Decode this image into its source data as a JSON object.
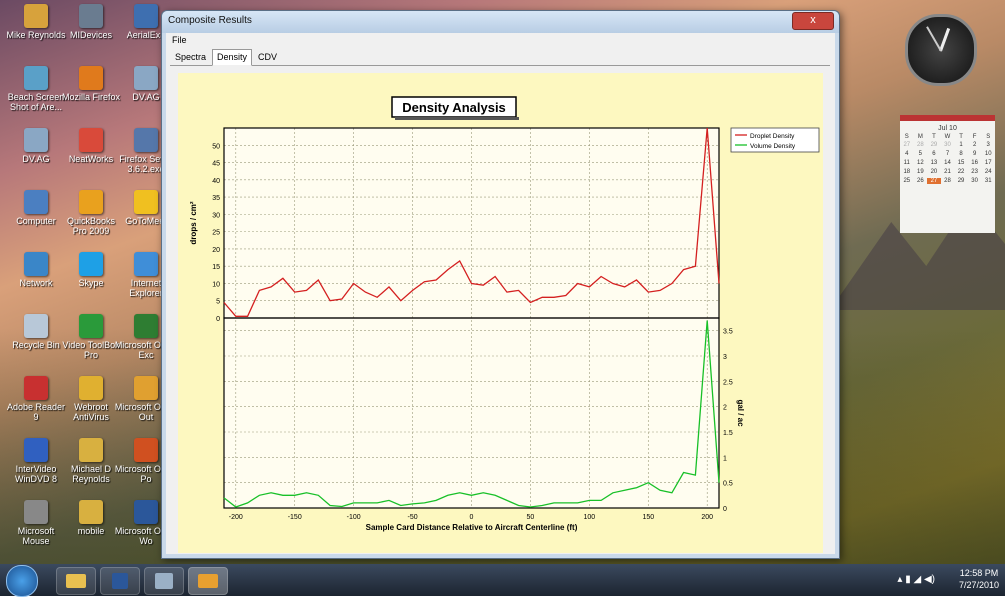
{
  "desktop": {
    "icons": [
      {
        "label": "Mike Reynolds",
        "color": "#d7a23c",
        "col": 0,
        "row": 0
      },
      {
        "label": "MIDevices",
        "color": "#6a7c90",
        "col": 1,
        "row": 0
      },
      {
        "label": "AerialExp",
        "color": "#3e6fb0",
        "col": 2,
        "row": 0
      },
      {
        "label": "Beach Screen Shot of Are...",
        "color": "#5aa0c8",
        "col": 0,
        "row": 1
      },
      {
        "label": "Mozilla Firefox",
        "color": "#e07a1c",
        "col": 1,
        "row": 1
      },
      {
        "label": "DV.AG",
        "color": "#8aa7c4",
        "col": 2,
        "row": 1
      },
      {
        "label": "DV.AG",
        "color": "#8aa7c4",
        "col": 0,
        "row": 2
      },
      {
        "label": "NeatWorks",
        "color": "#d94a3a",
        "col": 1,
        "row": 2
      },
      {
        "label": "Firefox Setup 3.6.2.exe",
        "color": "#5577aa",
        "col": 2,
        "row": 2
      },
      {
        "label": "Computer",
        "color": "#4b7fc1",
        "col": 0,
        "row": 3
      },
      {
        "label": "QuickBooks Pro 2009",
        "color": "#e9a11e",
        "col": 1,
        "row": 3
      },
      {
        "label": "GoToMeet",
        "color": "#f0c020",
        "col": 2,
        "row": 3
      },
      {
        "label": "Network",
        "color": "#3a86c8",
        "col": 0,
        "row": 4
      },
      {
        "label": "Skype",
        "color": "#1ea0e6",
        "col": 1,
        "row": 4
      },
      {
        "label": "Internet Explorer",
        "color": "#3f8ed8",
        "col": 2,
        "row": 4
      },
      {
        "label": "Recycle Bin",
        "color": "#b8c8d8",
        "col": 0,
        "row": 5
      },
      {
        "label": "Video ToolBox Pro",
        "color": "#2a9a3a",
        "col": 1,
        "row": 5
      },
      {
        "label": "Microsoft Office Exc",
        "color": "#2e7d32",
        "col": 2,
        "row": 5
      },
      {
        "label": "Adobe Reader 9",
        "color": "#c83030",
        "col": 0,
        "row": 6
      },
      {
        "label": "Webroot AntiVirus",
        "color": "#e0b030",
        "col": 1,
        "row": 6
      },
      {
        "label": "Microsoft Office Out",
        "color": "#e0a030",
        "col": 2,
        "row": 6
      },
      {
        "label": "InterVideo WinDVD 8",
        "color": "#3060c0",
        "col": 0,
        "row": 7
      },
      {
        "label": "Michael D Reynolds",
        "color": "#d8b040",
        "col": 1,
        "row": 7
      },
      {
        "label": "Microsoft Office Po",
        "color": "#d05020",
        "col": 2,
        "row": 7
      },
      {
        "label": "Microsoft Mouse",
        "color": "#888888",
        "col": 0,
        "row": 8
      },
      {
        "label": "mobile",
        "color": "#d8b040",
        "col": 1,
        "row": 8
      },
      {
        "label": "Microsoft Office Wo",
        "color": "#2b579a",
        "col": 2,
        "row": 8
      }
    ]
  },
  "window": {
    "title": "Composite Results",
    "close_label": "x",
    "menu": [
      "File"
    ],
    "tabs": [
      {
        "label": "Spectra",
        "active": false
      },
      {
        "label": "Density",
        "active": true
      },
      {
        "label": "CDV",
        "active": false
      }
    ]
  },
  "gadgets": {
    "calendar_header": "Jul 10",
    "weekdays": [
      "S",
      "M",
      "T",
      "W",
      "T",
      "F",
      "S"
    ],
    "days": [
      "27",
      "28",
      "29",
      "30",
      "1",
      "2",
      "3",
      "4",
      "5",
      "6",
      "7",
      "8",
      "9",
      "10",
      "11",
      "12",
      "13",
      "14",
      "15",
      "16",
      "17",
      "18",
      "19",
      "20",
      "21",
      "22",
      "23",
      "24",
      "25",
      "26",
      "27",
      "28",
      "29",
      "30",
      "31"
    ],
    "today": "27"
  },
  "taskbar": {
    "time": "12:58 PM",
    "date": "7/27/2010"
  },
  "chart_data": {
    "type": "line",
    "title": "Density Analysis",
    "xlabel": "Sample Card Distance Relative to Aircraft Centerline (ft)",
    "x_ticks": [
      -200,
      -150,
      -100,
      -50,
      0,
      50,
      100,
      150,
      200
    ],
    "xlim": [
      -210,
      210
    ],
    "legend": [
      "Droplet Density",
      "Volume Density"
    ],
    "legend_position": "top-right",
    "grid": true,
    "top_panel": {
      "ylabel": "drops / cm²",
      "ylim": [
        0,
        55
      ],
      "y_ticks": [
        0,
        5,
        10,
        15,
        20,
        25,
        30,
        35,
        40,
        45,
        50
      ],
      "series": [
        {
          "name": "Droplet Density",
          "color": "#d42020",
          "x": [
            -210,
            -200,
            -190,
            -180,
            -170,
            -160,
            -150,
            -140,
            -130,
            -120,
            -110,
            -100,
            -90,
            -80,
            -70,
            -60,
            -50,
            -40,
            -30,
            -20,
            -10,
            0,
            10,
            20,
            30,
            40,
            50,
            60,
            70,
            80,
            90,
            100,
            110,
            120,
            130,
            140,
            150,
            160,
            170,
            180,
            190,
            200,
            210
          ],
          "y": [
            4.5,
            0.5,
            0.5,
            8,
            9,
            11.5,
            7.5,
            8,
            11,
            5,
            5.5,
            10,
            7.5,
            6,
            9,
            5,
            8,
            10.5,
            11,
            14,
            16.5,
            10,
            9.5,
            12,
            7.5,
            8,
            4.5,
            6,
            6,
            6.5,
            10,
            9,
            12,
            10,
            9,
            11,
            7.5,
            8,
            10,
            14,
            15,
            55,
            10
          ]
        }
      ]
    },
    "bottom_panel": {
      "ylabel": "gal / ac",
      "ylim": [
        0,
        3.75
      ],
      "y_ticks": [
        0,
        0.5,
        1,
        1.5,
        2,
        2.5,
        3,
        3.5
      ],
      "series": [
        {
          "name": "Volume Density",
          "color": "#18c028",
          "x": [
            -210,
            -200,
            -190,
            -180,
            -170,
            -160,
            -150,
            -140,
            -130,
            -120,
            -110,
            -100,
            -90,
            -80,
            -70,
            -60,
            -50,
            -40,
            -30,
            -20,
            -10,
            0,
            10,
            20,
            30,
            40,
            50,
            60,
            70,
            80,
            90,
            100,
            110,
            120,
            130,
            140,
            150,
            160,
            170,
            180,
            190,
            200,
            210
          ],
          "y": [
            0.2,
            0.02,
            0.1,
            0.25,
            0.3,
            0.25,
            0.25,
            0.3,
            0.25,
            0.05,
            0.03,
            0.1,
            0.1,
            0.1,
            0.15,
            0.05,
            0.08,
            0.1,
            0.15,
            0.25,
            0.3,
            0.25,
            0.3,
            0.25,
            0.15,
            0.05,
            0.02,
            0.05,
            0.1,
            0.1,
            0.1,
            0.15,
            0.15,
            0.3,
            0.35,
            0.4,
            0.5,
            0.35,
            0.3,
            0.7,
            0.65,
            3.7,
            0.5
          ]
        }
      ]
    }
  }
}
